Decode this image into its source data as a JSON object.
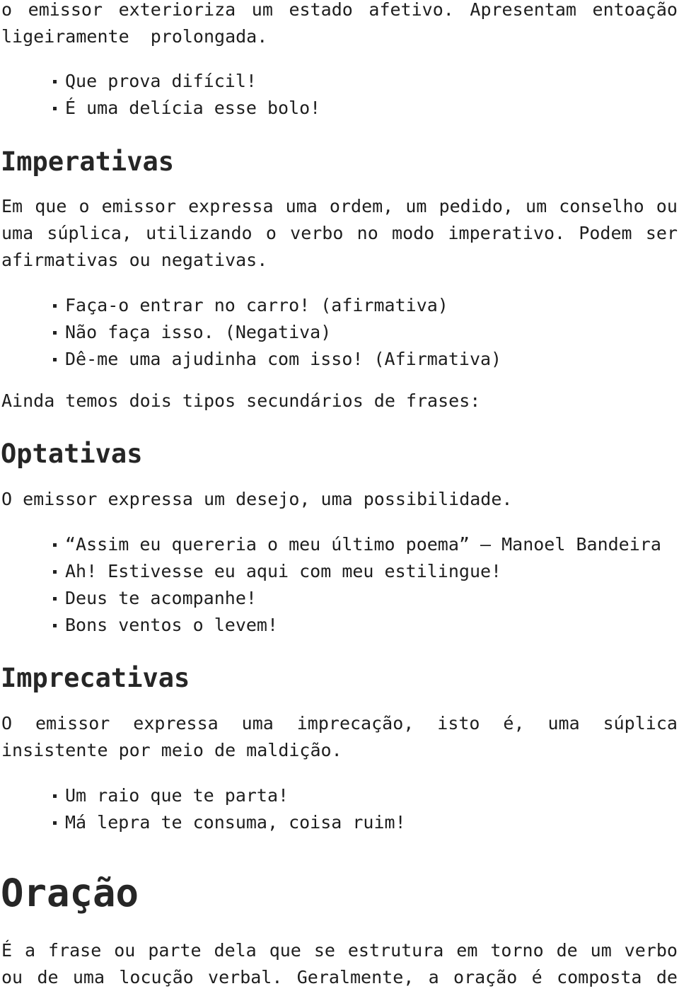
{
  "intro": {
    "line1": "o emissor exterioriza um estado afetivo. Apresentam entoação",
    "line2": "ligeiramente  prolongada.",
    "examples": [
      "Que prova difícil!",
      "É uma delícia esse bolo!"
    ]
  },
  "imperativas": {
    "heading": "Imperativas",
    "line1": "Em que o emissor expressa uma ordem, um pedido, um conselho ou",
    "line2": "uma súplica, utilizando o verbo no modo imperativo. Podem ser",
    "line3": "afirmativas ou negativas.",
    "examples": [
      "Faça-o entrar no carro! (afirmativa)",
      "Não faça isso. (Negativa)",
      "Dê-me uma ajudinha com isso! (Afirmativa)"
    ]
  },
  "secondary_intro": "Ainda temos dois tipos secundários de frases:",
  "optativas": {
    "heading": "Optativas",
    "line1": "O emissor expressa um desejo, uma possibilidade.",
    "examples": [
      "“Assim eu quereria o meu último poema” – Manoel Bandeira",
      "Ah! Estivesse eu aqui com meu estilingue!",
      "Deus te acompanhe!",
      "Bons ventos o levem!"
    ]
  },
  "imprecativas": {
    "heading": "Imprecativas",
    "line1_words": [
      "O",
      "emissor",
      "expressa",
      "uma",
      "imprecação,",
      "isto",
      "é,",
      "uma",
      "súplica"
    ],
    "line2": "insistente por meio de maldição.",
    "examples": [
      "Um raio que te parta!",
      "Má lepra te consuma, coisa ruim!"
    ]
  },
  "oracao": {
    "heading": "Oração",
    "line1_words": [
      "É",
      "a",
      "frase",
      "ou",
      "parte",
      "dela",
      "que",
      "se",
      "estrutura",
      "em",
      "torno",
      "de",
      "um",
      "verbo"
    ],
    "line2_words": [
      "ou",
      "de",
      "uma",
      "locução",
      "verbal.",
      "Geralmente,",
      "a",
      "oração",
      "é",
      "composta",
      "de"
    ]
  }
}
